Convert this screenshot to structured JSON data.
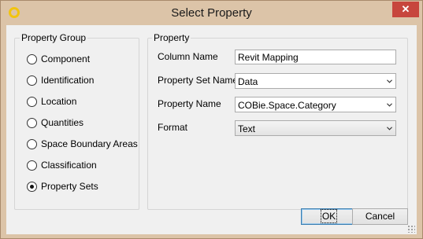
{
  "window": {
    "title": "Select Property",
    "close_glyph": "✕",
    "app_icon": "ring-icon"
  },
  "property_group": {
    "legend": "Property Group",
    "options": [
      {
        "label": "Component",
        "checked": false
      },
      {
        "label": "Identification",
        "checked": false
      },
      {
        "label": "Location",
        "checked": false
      },
      {
        "label": "Quantities",
        "checked": false
      },
      {
        "label": "Space Boundary Areas",
        "checked": false
      },
      {
        "label": "Classification",
        "checked": false
      },
      {
        "label": "Property Sets",
        "checked": true
      }
    ]
  },
  "property": {
    "legend": "Property",
    "column_name_label": "Column Name",
    "column_name_value": "Revit Mapping",
    "property_set_name_label": "Property Set Name",
    "property_set_name_value": "Data",
    "property_name_label": "Property Name",
    "property_name_value": "COBie.Space.Category",
    "format_label": "Format",
    "format_value": "Text"
  },
  "buttons": {
    "ok": "OK",
    "cancel": "Cancel"
  },
  "colors": {
    "title_bar": "#dcc4a8",
    "close_button": "#c7463d",
    "app_icon": "#f2c40e",
    "default_button_border": "#3c7fb1"
  }
}
